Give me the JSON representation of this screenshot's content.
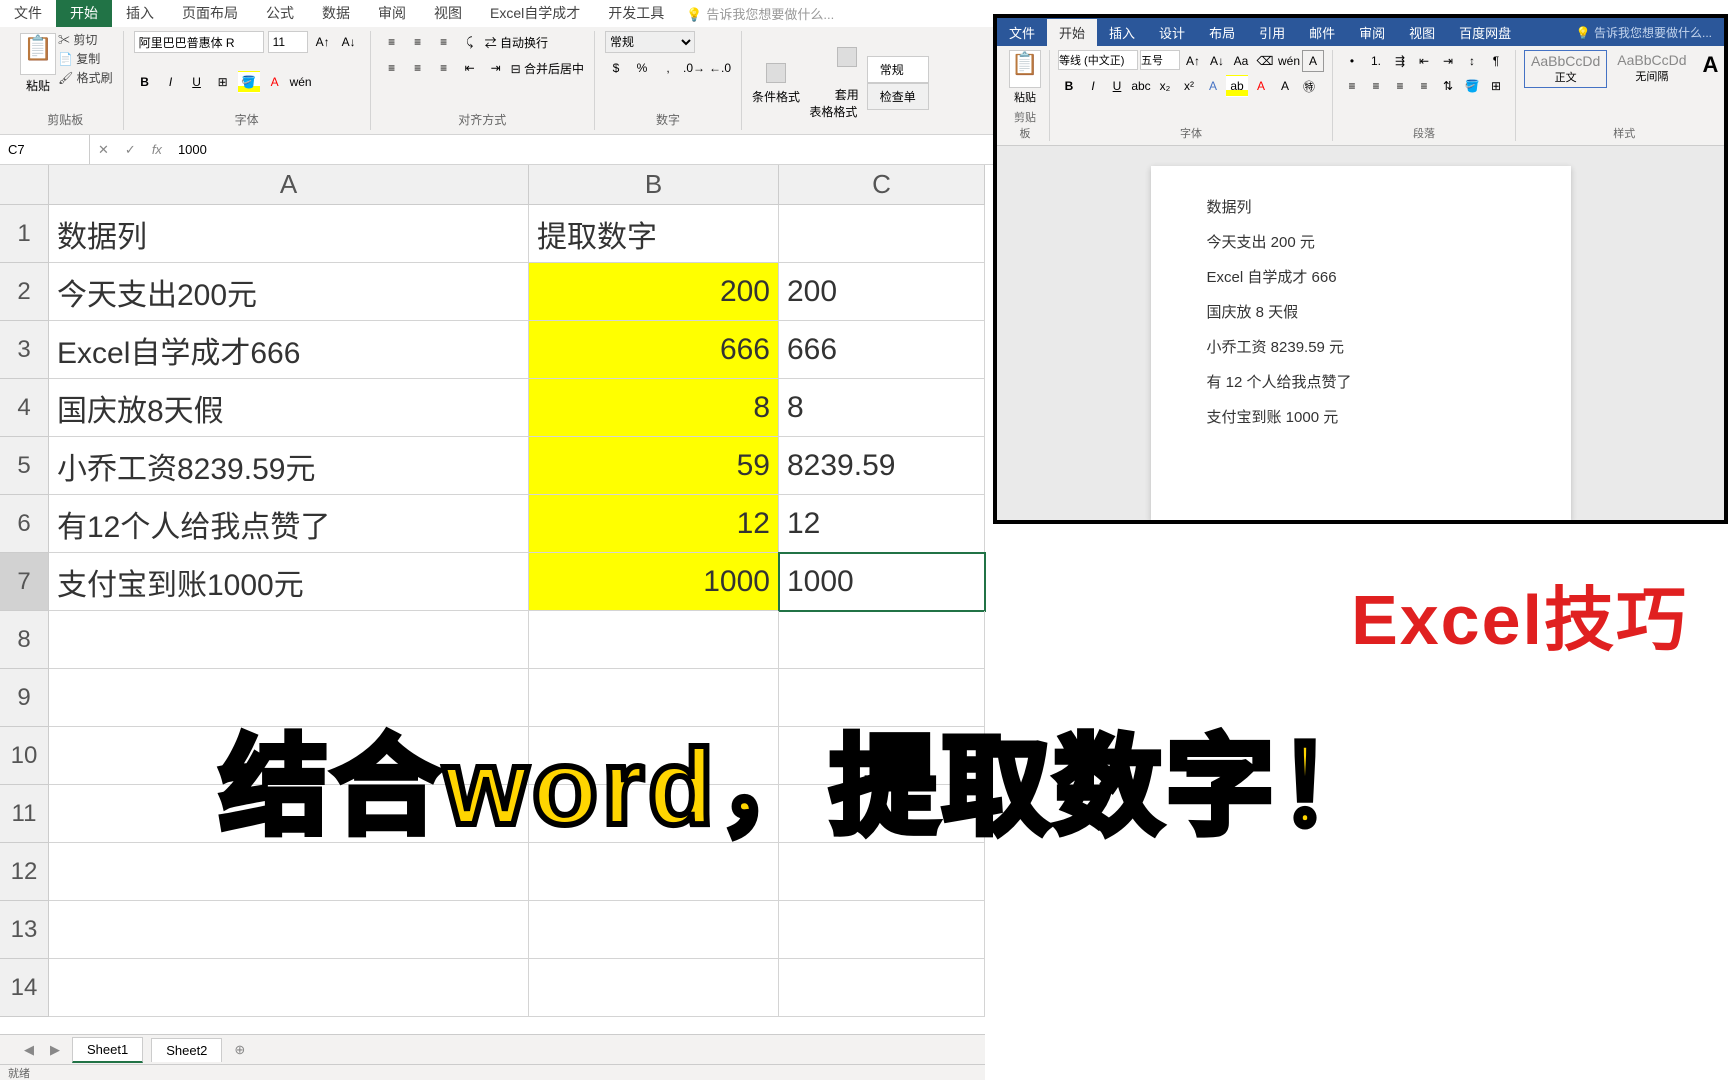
{
  "excel": {
    "tabs": [
      "文件",
      "开始",
      "插入",
      "页面布局",
      "公式",
      "数据",
      "审阅",
      "视图",
      "Excel自学成才",
      "开发工具"
    ],
    "active_tab": "开始",
    "tellme": "告诉我您想要做什么...",
    "ribbon": {
      "clipboard": {
        "paste": "粘贴",
        "cut": "剪切",
        "copy": "复制",
        "brush": "格式刷",
        "label": "剪贴板"
      },
      "font": {
        "name": "阿里巴巴普惠体 R",
        "size": "11",
        "label": "字体",
        "bold": "B",
        "italic": "I",
        "underline": "U",
        "wen": "wén"
      },
      "align": {
        "wrap": "自动换行",
        "merge": "合并后居中",
        "label": "对齐方式"
      },
      "number": {
        "general": "常规",
        "label": "数字"
      },
      "styles": {
        "cond": "条件格式",
        "table": "套用\n表格格式",
        "normal": "常规",
        "check": "检查单"
      }
    },
    "namebox": {
      "ref": "C7",
      "fx": "fx",
      "val": "1000"
    },
    "cols": [
      "A",
      "B",
      "C"
    ],
    "rows": [
      "1",
      "2",
      "3",
      "4",
      "5",
      "6",
      "7",
      "8",
      "9",
      "10",
      "11",
      "12",
      "13",
      "14"
    ],
    "data": [
      {
        "a": "数据列",
        "b": "提取数字",
        "c": ""
      },
      {
        "a": "今天支出200元",
        "b": "200",
        "c": "200"
      },
      {
        "a": "Excel自学成才666",
        "b": "666",
        "c": "666"
      },
      {
        "a": "国庆放8天假",
        "b": "8",
        "c": "8"
      },
      {
        "a": "小乔工资8239.59元",
        "b": "59",
        "c": "8239.59"
      },
      {
        "a": "有12个人给我点赞了",
        "b": "12",
        "c": "12"
      },
      {
        "a": "支付宝到账1000元",
        "b": "1000",
        "c": "1000"
      }
    ],
    "sheets": [
      "Sheet1",
      "Sheet2"
    ],
    "status": "就绪"
  },
  "word": {
    "tabs": [
      "文件",
      "开始",
      "插入",
      "设计",
      "布局",
      "引用",
      "邮件",
      "审阅",
      "视图",
      "百度网盘"
    ],
    "active_tab": "开始",
    "tellme": "告诉我您想要做什么...",
    "ribbon": {
      "clipboard": {
        "paste": "粘贴",
        "label": "剪贴板"
      },
      "font": {
        "name": "等线 (中文正)",
        "size": "五号",
        "label": "字体"
      },
      "para": {
        "label": "段落"
      },
      "styles": {
        "normal": "正文",
        "nospace": "无间隔",
        "sample": "AaBbCcDd",
        "label": "样式"
      }
    },
    "doc": [
      "数据列",
      "今天支出 200 元",
      "Excel 自学成才 666",
      "国庆放 8 天假",
      "小乔工资 8239.59 元",
      "有 12 个人给我点赞了",
      "支付宝到账 1000 元"
    ]
  },
  "overlay": {
    "title": "Excel技巧",
    "subtitle": "结合word，提取数字！"
  }
}
